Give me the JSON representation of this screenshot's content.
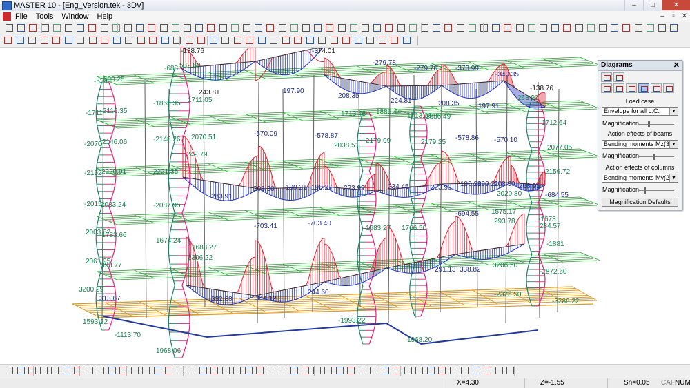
{
  "window": {
    "title": "MASTER 10 - [Eng_Version.tek - 3DV]",
    "controls": {
      "minimize": "–",
      "maximize": "□",
      "close": "✕"
    }
  },
  "menubar": {
    "items": [
      "File",
      "Tools",
      "Window",
      "Help"
    ],
    "mdi_controls": {
      "minimize": "–",
      "restore": "▫",
      "close": "✕"
    }
  },
  "panel": {
    "title": "Diagrams",
    "close": "✕",
    "load_case_label": "Load case",
    "load_case_value": "Envelope for all L.C.",
    "magnification_label": "Magnification",
    "beams_label": "Action effects of beams",
    "beams_value": "Bending moments Mz(3)",
    "columns_label": "Action effects of columns",
    "columns_value": "Bending moments My(2)",
    "defaults_button": "Magnification Defaults",
    "dropdown_arrow": "▼"
  },
  "diagram": {
    "colors": {
      "grid_green": "#1f9a2a",
      "floor_orange": "#d89a24",
      "column": "#6a6a6a",
      "beam_positive": "#dd2233",
      "beam_negative": "#2233bb",
      "col_pink": "#e0207a",
      "col_teal": "#22806a",
      "label_blue": "#1e2b8e",
      "label_green": "#17804f",
      "label_black": "#222"
    },
    "labels": [
      {
        "text": "-138.76",
        "color": "label_black"
      },
      {
        "text": "-374.01",
        "color": "label_black"
      },
      {
        "text": "-279.78",
        "color": "label_blue"
      },
      {
        "text": "-279.76",
        "color": "label_blue"
      },
      {
        "text": "-373.99",
        "color": "label_blue"
      },
      {
        "text": "-340.35",
        "color": "label_blue"
      },
      {
        "text": "-138.76",
        "color": "label_black"
      },
      {
        "text": "-534",
        "color": "label_green"
      },
      {
        "text": "-688",
        "color": "label_green"
      },
      {
        "text": "500.25",
        "color": "label_green"
      },
      {
        "text": "532.80",
        "color": "label_green"
      },
      {
        "text": "243.81",
        "color": "label_black"
      },
      {
        "text": "197.90",
        "color": "label_blue"
      },
      {
        "text": "208.35",
        "color": "label_blue"
      },
      {
        "text": "224.81",
        "color": "label_blue"
      },
      {
        "text": "208.35",
        "color": "label_blue"
      },
      {
        "text": "197.91",
        "color": "label_blue"
      },
      {
        "text": "263.90",
        "color": "label_green"
      },
      {
        "text": "-1711",
        "color": "label_green"
      },
      {
        "text": "2116.35",
        "color": "label_green"
      },
      {
        "text": "-1865.35",
        "color": "label_green"
      },
      {
        "text": "1711.05",
        "color": "label_green"
      },
      {
        "text": "1886.44",
        "color": "label_green"
      },
      {
        "text": "1713.48",
        "color": "label_green"
      },
      {
        "text": "1886.49",
        "color": "label_green"
      },
      {
        "text": "1713.08",
        "color": "label_green"
      },
      {
        "text": "1712.64",
        "color": "label_green"
      },
      {
        "text": "-2070",
        "color": "label_green"
      },
      {
        "text": "2146.06",
        "color": "label_green"
      },
      {
        "text": "-2148.26",
        "color": "label_green"
      },
      {
        "text": "2070.51",
        "color": "label_green"
      },
      {
        "text": "-570.09",
        "color": "label_blue"
      },
      {
        "text": "-578.87",
        "color": "label_blue"
      },
      {
        "text": "2038.51",
        "color": "label_green"
      },
      {
        "text": "2179.09",
        "color": "label_green"
      },
      {
        "text": "2179.25",
        "color": "label_green"
      },
      {
        "text": "-578.86",
        "color": "label_blue"
      },
      {
        "text": "-570.10",
        "color": "label_blue"
      },
      {
        "text": "2077.05",
        "color": "label_green"
      },
      {
        "text": "-2152",
        "color": "label_green"
      },
      {
        "text": "2220.91",
        "color": "label_green"
      },
      {
        "text": "2221.35",
        "color": "label_green"
      },
      {
        "text": "242.79",
        "color": "label_green"
      },
      {
        "text": "2159.72",
        "color": "label_green"
      },
      {
        "text": "283.91",
        "color": "label_blue"
      },
      {
        "text": "208.30",
        "color": "label_blue"
      },
      {
        "text": "199.21",
        "color": "label_blue"
      },
      {
        "text": "190.27",
        "color": "label_blue"
      },
      {
        "text": "223.99",
        "color": "label_blue"
      },
      {
        "text": "234.45",
        "color": "label_blue"
      },
      {
        "text": "223.99",
        "color": "label_blue"
      },
      {
        "text": "190.28",
        "color": "label_blue"
      },
      {
        "text": "199.21",
        "color": "label_blue"
      },
      {
        "text": "208.30",
        "color": "label_blue"
      },
      {
        "text": "263.91",
        "color": "label_blue"
      },
      {
        "text": "-2015",
        "color": "label_green"
      },
      {
        "text": "2033.24",
        "color": "label_green"
      },
      {
        "text": "-2087.95",
        "color": "label_green"
      },
      {
        "text": "2020.80",
        "color": "label_green"
      },
      {
        "text": "-684.55",
        "color": "label_blue"
      },
      {
        "text": "-703.41",
        "color": "label_blue"
      },
      {
        "text": "-703.40",
        "color": "label_blue"
      },
      {
        "text": "-694.55",
        "color": "label_blue"
      },
      {
        "text": "1575.17",
        "color": "label_green"
      },
      {
        "text": "-1673",
        "color": "label_green"
      },
      {
        "text": "2003.82",
        "color": "label_green"
      },
      {
        "text": "-1783.66",
        "color": "label_green"
      },
      {
        "text": "1674.24",
        "color": "label_green"
      },
      {
        "text": "1683.27",
        "color": "label_green"
      },
      {
        "text": "1683.27",
        "color": "label_green"
      },
      {
        "text": "1766.50",
        "color": "label_green"
      },
      {
        "text": "293.78",
        "color": "label_green"
      },
      {
        "text": "284.57",
        "color": "label_green"
      },
      {
        "text": "-1881",
        "color": "label_green"
      },
      {
        "text": "2061.95",
        "color": "label_green"
      },
      {
        "text": "393.77",
        "color": "label_green"
      },
      {
        "text": "2306.22",
        "color": "label_green"
      },
      {
        "text": "-2872.60",
        "color": "label_green"
      },
      {
        "text": "3200.29",
        "color": "label_green"
      },
      {
        "text": "313.67",
        "color": "label_blue"
      },
      {
        "text": "332.88",
        "color": "label_blue"
      },
      {
        "text": "344.12",
        "color": "label_blue"
      },
      {
        "text": "244.60",
        "color": "label_blue"
      },
      {
        "text": "291.13",
        "color": "label_blue"
      },
      {
        "text": "338.82",
        "color": "label_blue"
      },
      {
        "text": "3206.50",
        "color": "label_green"
      },
      {
        "text": "-2325.50",
        "color": "label_green"
      },
      {
        "text": "-3286.22",
        "color": "label_green"
      },
      {
        "text": "1593.22",
        "color": "label_green"
      },
      {
        "text": "-1113.70",
        "color": "label_green"
      },
      {
        "text": "-1993.22",
        "color": "label_green"
      },
      {
        "text": "1968.06",
        "color": "label_green"
      },
      {
        "text": "1968.20",
        "color": "label_green"
      }
    ]
  },
  "status": {
    "x": "X=4.30",
    "z": "Z=-1.55",
    "sn": "Sn=0.05",
    "caf": "CAF",
    "num": "NUM"
  }
}
